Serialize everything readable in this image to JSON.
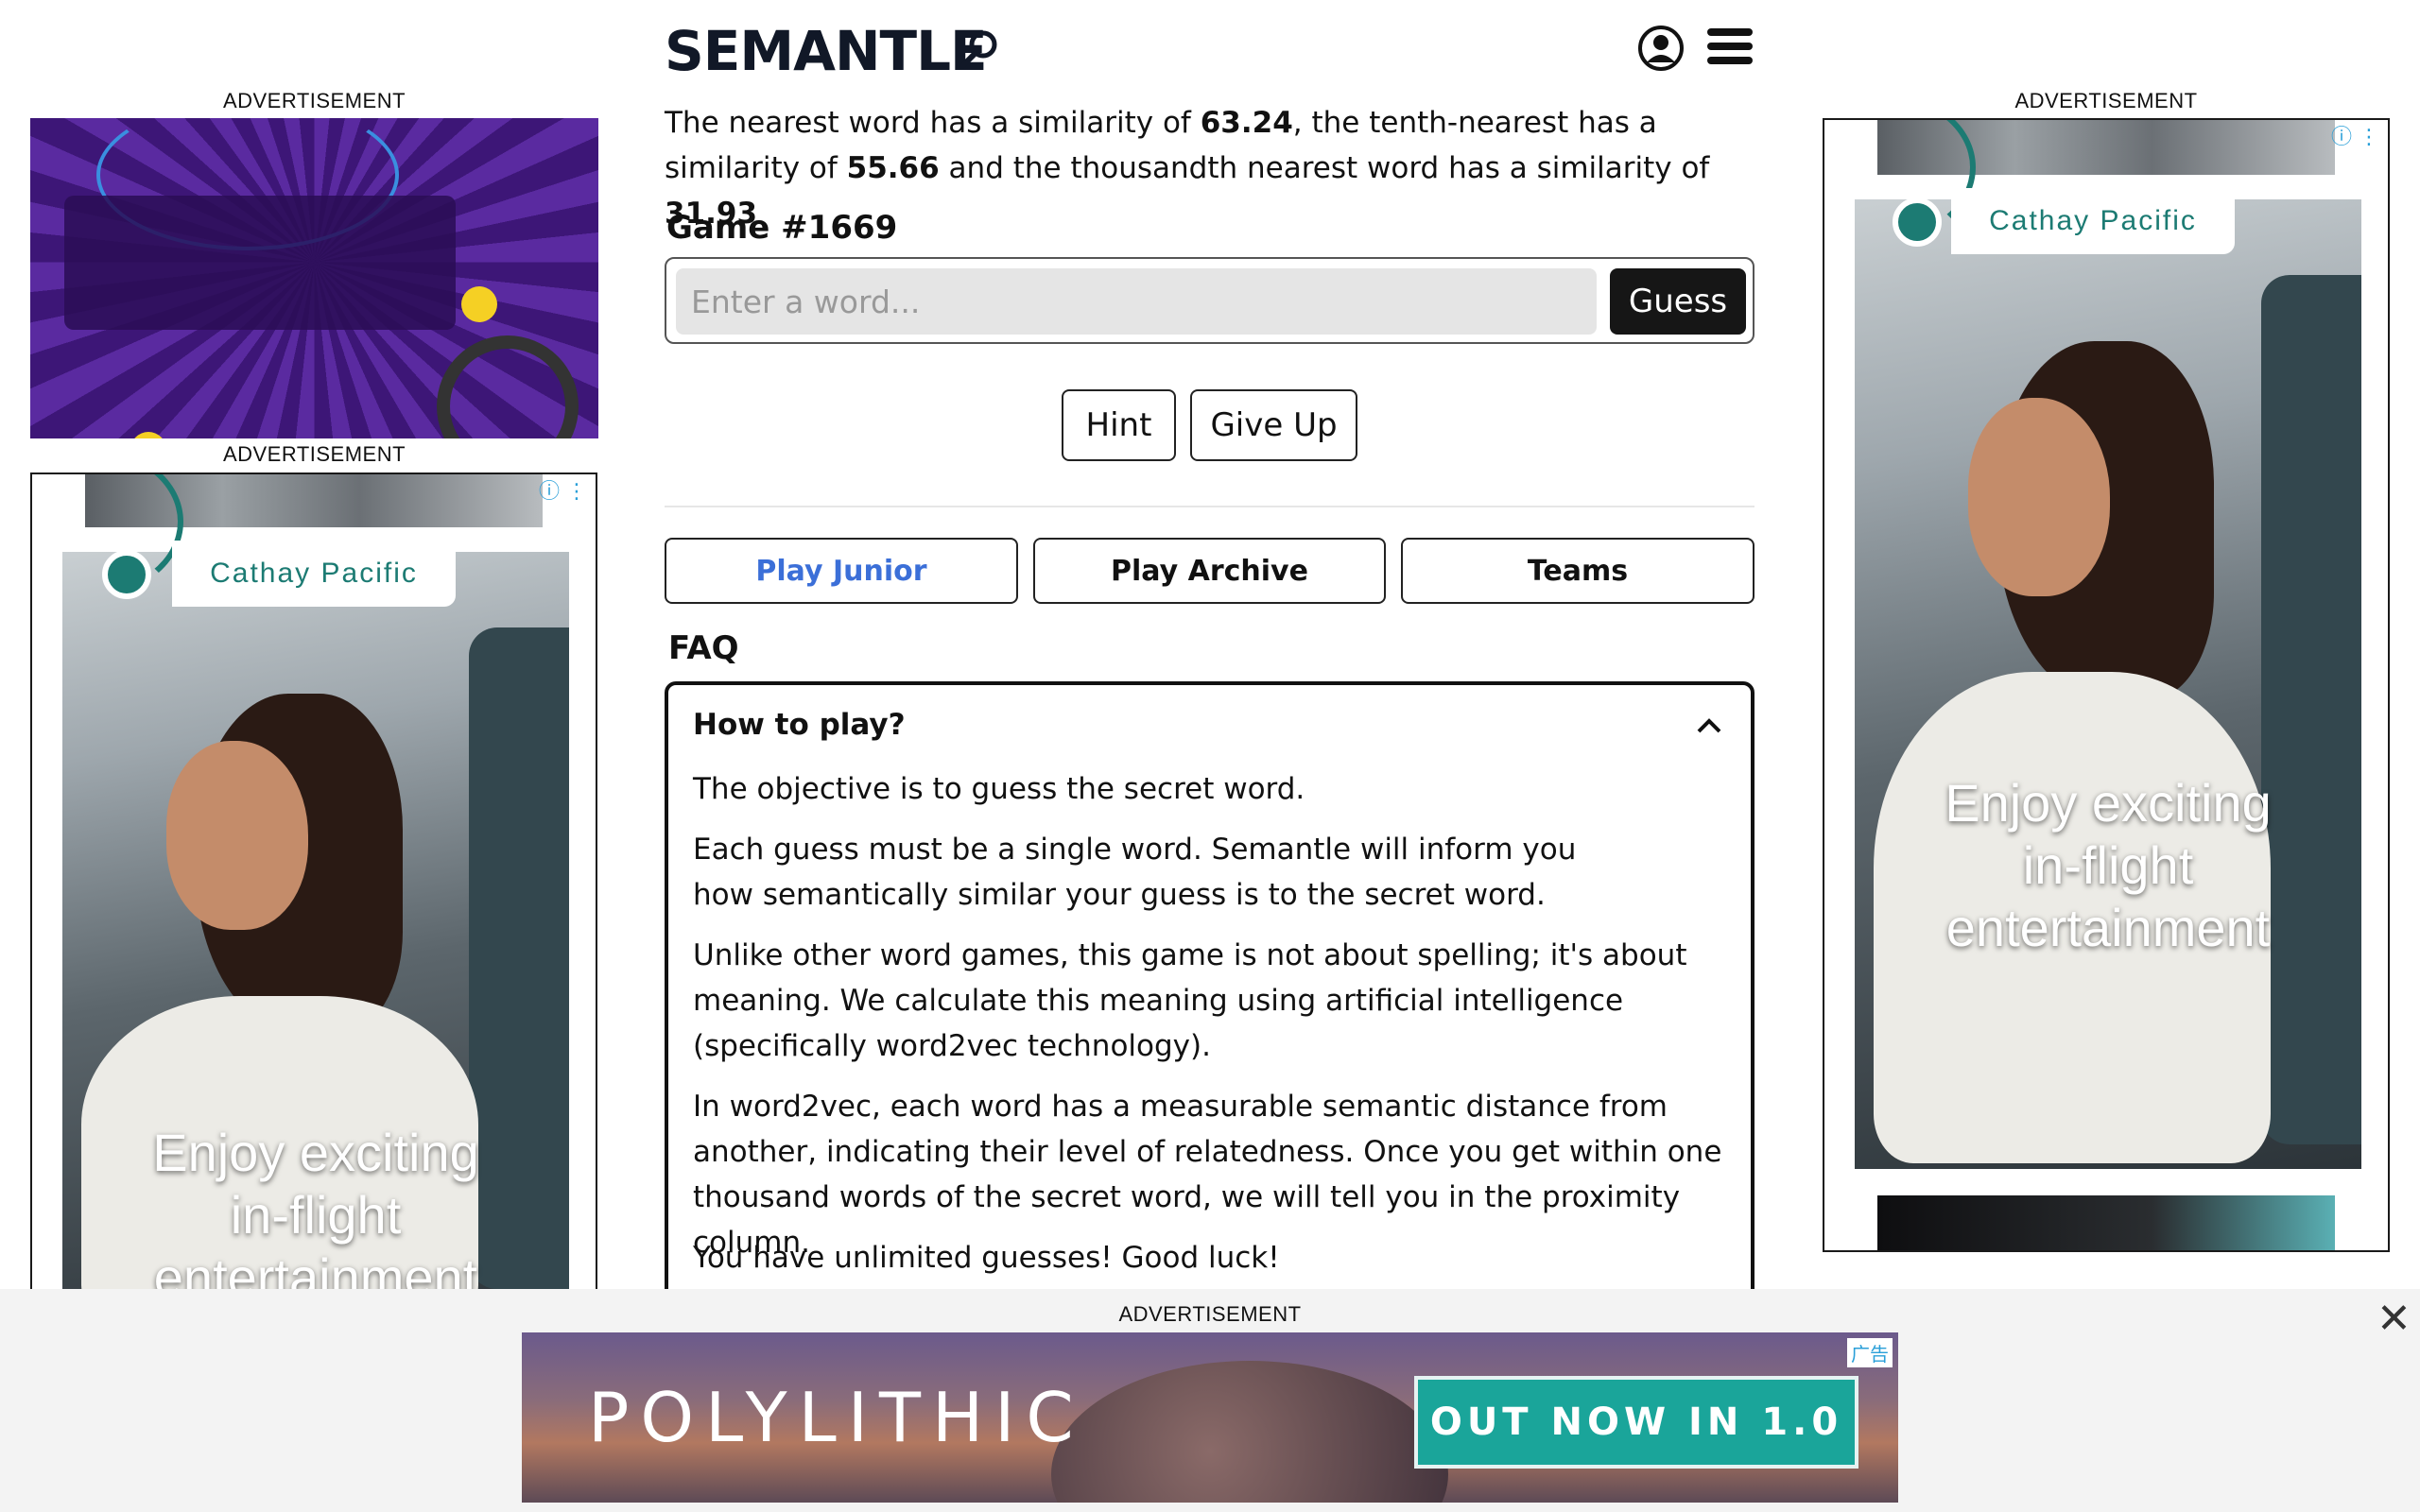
{
  "header": {
    "logo": "SEMANTLE",
    "logo_icon": "search-icon",
    "user_icon": "user-circle-icon",
    "menu_icon": "hamburger-menu-icon"
  },
  "intro": {
    "part1": "The nearest word has a similarity of ",
    "nearest": "63.24",
    "part2": ", the tenth-nearest has a similarity of ",
    "tenth": "55.66",
    "part3": " and the thousandth nearest word has a similarity of ",
    "thousandth": "31.93"
  },
  "game": {
    "label": "Game #1669",
    "input_placeholder": "Enter a word...",
    "guess_label": "Guess",
    "hint_label": "Hint",
    "giveup_label": "Give Up"
  },
  "modes": {
    "junior": "Play Junior",
    "archive": "Play Archive",
    "teams": "Teams",
    "junior_color": "#3b6fd8"
  },
  "faq": {
    "title": "FAQ",
    "question": "How to play?",
    "paragraphs": [
      "The objective is to guess the secret word.",
      "Each guess must be a single word. Semantle will inform you how semantically similar your guess is to the secret word.",
      "Unlike other word games, this game is not about spelling; it's about meaning. We calculate this meaning using artificial intelligence (specifically word2vec technology).",
      "In word2vec, each word has a measurable semantic distance from another, indicating their level of relatedness. Once you get within one thousand words of the secret word, we will tell you in the proximity column.",
      "You have unlimited guesses! Good luck!"
    ]
  },
  "ads": {
    "label": "ADVERTISEMENT",
    "cathay_brand": "Cathay Pacific",
    "cathay_slogan_l1": "Enjoy exciting",
    "cathay_slogan_l2": "in-flight",
    "cathay_slogan_l3": "entertainment",
    "bottom_brand": "POLYLITHIC",
    "bottom_cta": "OUT NOW IN 1.0",
    "bottom_adchoice": "广告",
    "close_glyph": "✕"
  }
}
